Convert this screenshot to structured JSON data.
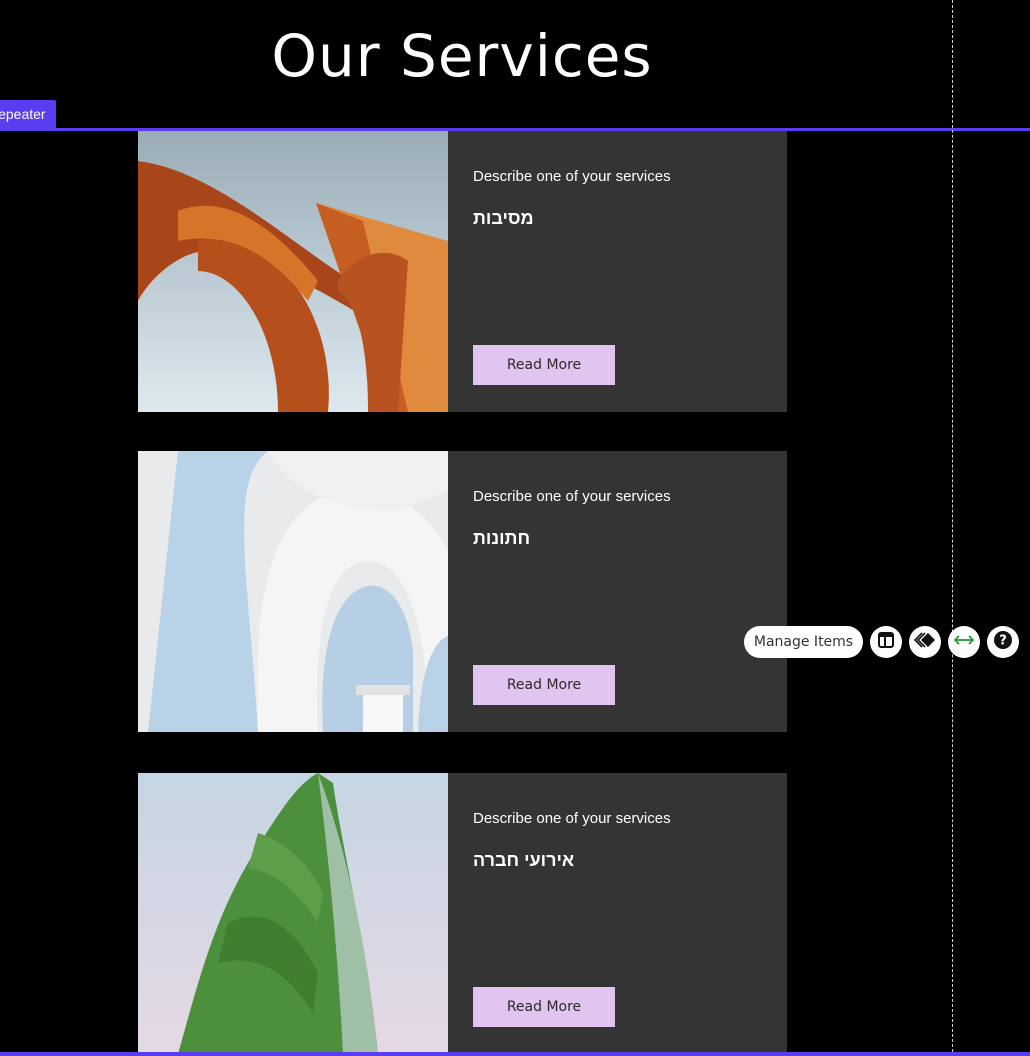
{
  "page": {
    "title": "Our Services"
  },
  "editor": {
    "repeater_tag": "Repeater",
    "manage_items_label": "Manage Items",
    "tools": [
      {
        "icon": "layout-icon"
      },
      {
        "icon": "animation-icon"
      },
      {
        "icon": "stretch-icon"
      },
      {
        "icon": "help-icon"
      }
    ],
    "accent_color": "#5a3df0"
  },
  "services": [
    {
      "description": "Describe one of your services",
      "title": "מסיבות",
      "button_label": "Read More",
      "image": "orange-arch-sculpture"
    },
    {
      "description": "Describe one of your services",
      "title": "חתונות",
      "button_label": "Read More",
      "image": "white-arches"
    },
    {
      "description": "Describe one of your services",
      "title": "אירועי חברה",
      "button_label": "Read More",
      "image": "green-leaf"
    }
  ],
  "colors": {
    "card_bg": "#353435",
    "button_bg": "#e2c4f0"
  }
}
